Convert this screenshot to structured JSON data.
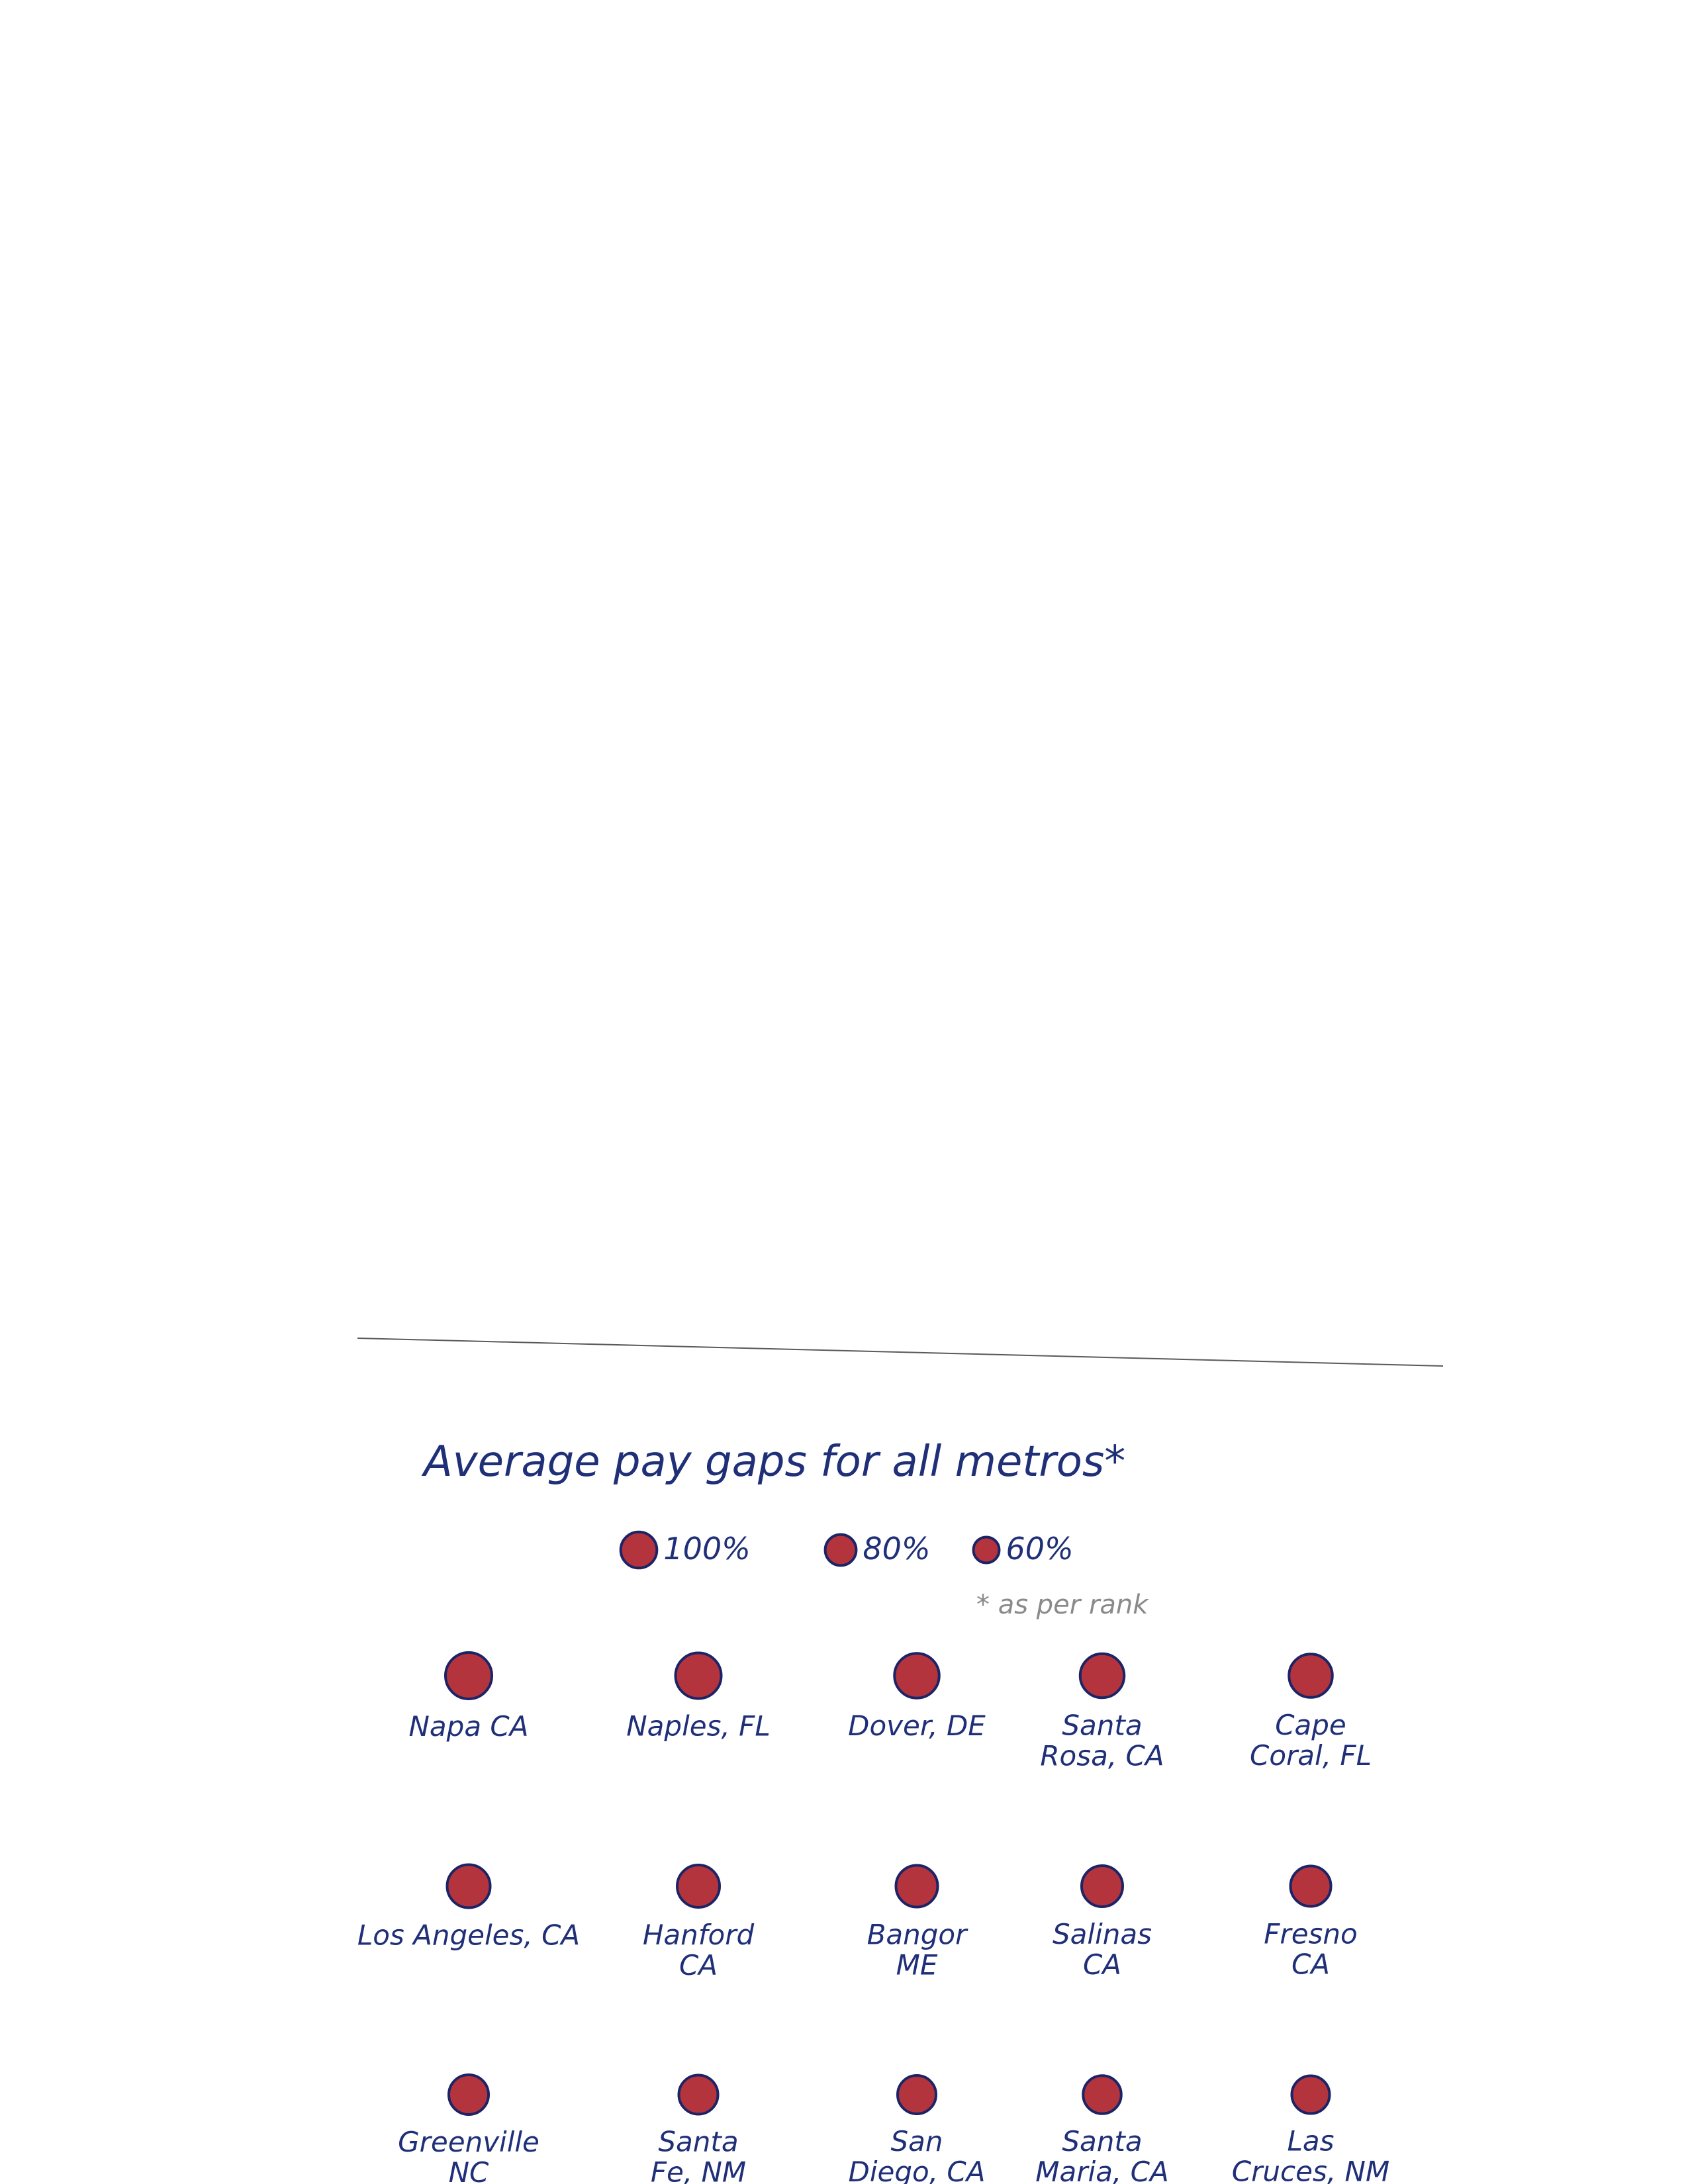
{
  "chart_data": {
    "type": "scatter",
    "title": "Average pay gaps for all metros*",
    "footnote": "* as per rank",
    "legend": [
      {
        "label": "100%",
        "value": 100
      },
      {
        "label": "80%",
        "value": 80
      },
      {
        "label": "60%",
        "value": 60
      }
    ],
    "points": [
      {
        "label": [
          "Napa CA"
        ],
        "value": 100
      },
      {
        "label": [
          "Naples, FL"
        ],
        "value": 98
      },
      {
        "label": [
          "Dover, DE"
        ],
        "value": 95
      },
      {
        "label": [
          "Santa",
          "Rosa, CA"
        ],
        "value": 93
      },
      {
        "label": [
          "Cape",
          "Coral, FL"
        ],
        "value": 91
      },
      {
        "label": [
          "Los Angeles, CA"
        ],
        "value": 90
      },
      {
        "label": [
          "Hanford",
          "CA"
        ],
        "value": 88
      },
      {
        "label": [
          "Bangor",
          "ME"
        ],
        "value": 86
      },
      {
        "label": [
          "Salinas",
          "CA"
        ],
        "value": 84
      },
      {
        "label": [
          "Fresno",
          "CA"
        ],
        "value": 82
      },
      {
        "label": [
          "Greenville",
          "NC"
        ],
        "value": 80
      },
      {
        "label": [
          "Santa",
          "Fe, NM"
        ],
        "value": 78
      },
      {
        "label": [
          "San",
          "Diego, CA"
        ],
        "value": 76
      },
      {
        "label": [
          "Santa",
          "Maria, CA"
        ],
        "value": 75
      },
      {
        "label": [
          "Las",
          "Cruces, NM"
        ],
        "value": 74
      }
    ],
    "colors": {
      "dot_fill": "#b4343e",
      "dot_outline": "#1c2466",
      "ink": "#1f2f78",
      "pencil": "#8a8a8a"
    }
  }
}
